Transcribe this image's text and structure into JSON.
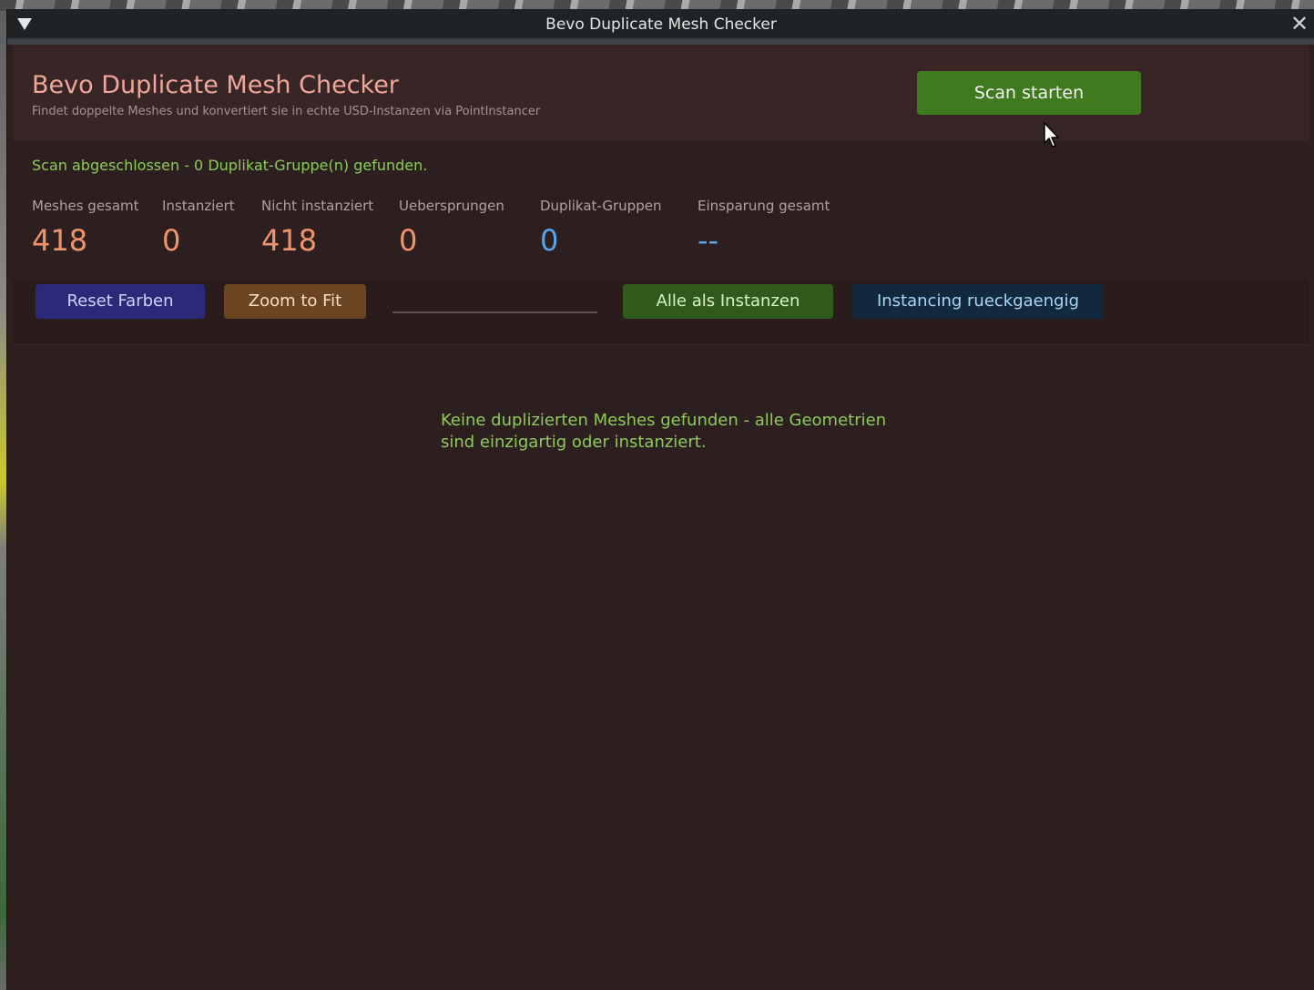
{
  "window": {
    "title": "Bevo Duplicate Mesh Checker",
    "close_glyph": "✕"
  },
  "header": {
    "title": "Bevo Duplicate Mesh Checker",
    "subtitle": "Findet doppelte Meshes und konvertiert sie in echte USD-Instanzen via PointInstancer",
    "scan_button": "Scan starten"
  },
  "status": {
    "message": "Scan abgeschlossen  -  0 Duplikat-Gruppe(n) gefunden."
  },
  "stats": [
    {
      "label": "Meshes gesamt",
      "value": "418"
    },
    {
      "label": "Instanziert",
      "value": "0"
    },
    {
      "label": "Nicht instanziert",
      "value": "418"
    },
    {
      "label": "Uebersprungen",
      "value": "0"
    },
    {
      "label": "Duplikat-Gruppen",
      "value": "0"
    },
    {
      "label": "Einsparung gesamt",
      "value": "--"
    }
  ],
  "toolbar": {
    "reset_label": "Reset Farben",
    "zoom_label": "Zoom to Fit",
    "search_value": "",
    "instance_all_label": "Alle als Instanzen",
    "undo_label": "Instancing rueckgaengig"
  },
  "results": {
    "empty_message_line1": "Keine duplizierten Meshes gefunden - alle Geometrien",
    "empty_message_line2": "sind einzigartig oder instanziert."
  },
  "colors": {
    "accent_green": "#8ccb57",
    "stat_orange": "#f0946b",
    "stat_blue": "#58a5eb",
    "title_salmon": "#f0a69a"
  },
  "icons": {
    "window_menu": "triangle-down-icon",
    "close": "close-icon",
    "cursor": "mouse-pointer-icon"
  }
}
